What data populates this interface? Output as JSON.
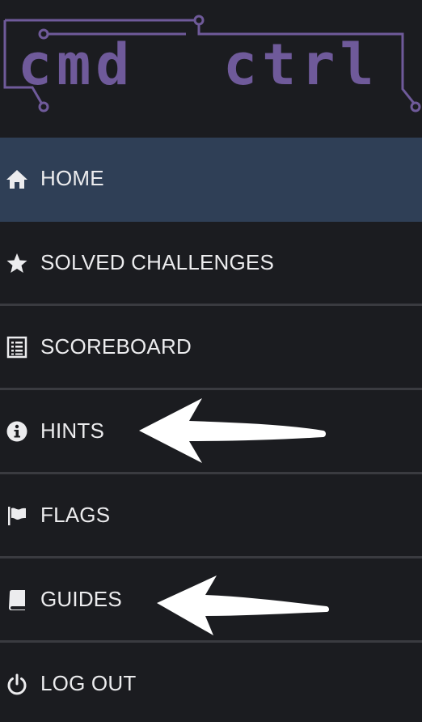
{
  "logo": {
    "text_left": "cmd",
    "text_right": "ctrl",
    "color": "#6f5a9a"
  },
  "nav": {
    "items": [
      {
        "label": "HOME",
        "icon": "home-icon",
        "active": true
      },
      {
        "label": "SOLVED CHALLENGES",
        "icon": "star-icon",
        "active": false
      },
      {
        "label": "SCOREBOARD",
        "icon": "list-icon",
        "active": false
      },
      {
        "label": "HINTS",
        "icon": "info-icon",
        "active": false
      },
      {
        "label": "FLAGS",
        "icon": "flag-icon",
        "active": false
      },
      {
        "label": "GUIDES",
        "icon": "book-icon",
        "active": false
      },
      {
        "label": "LOG OUT",
        "icon": "power-icon",
        "active": false
      }
    ]
  },
  "colors": {
    "background": "#1b1c20",
    "active_background": "#2f3f56",
    "divider": "#3a3b40",
    "text": "#ececee"
  }
}
